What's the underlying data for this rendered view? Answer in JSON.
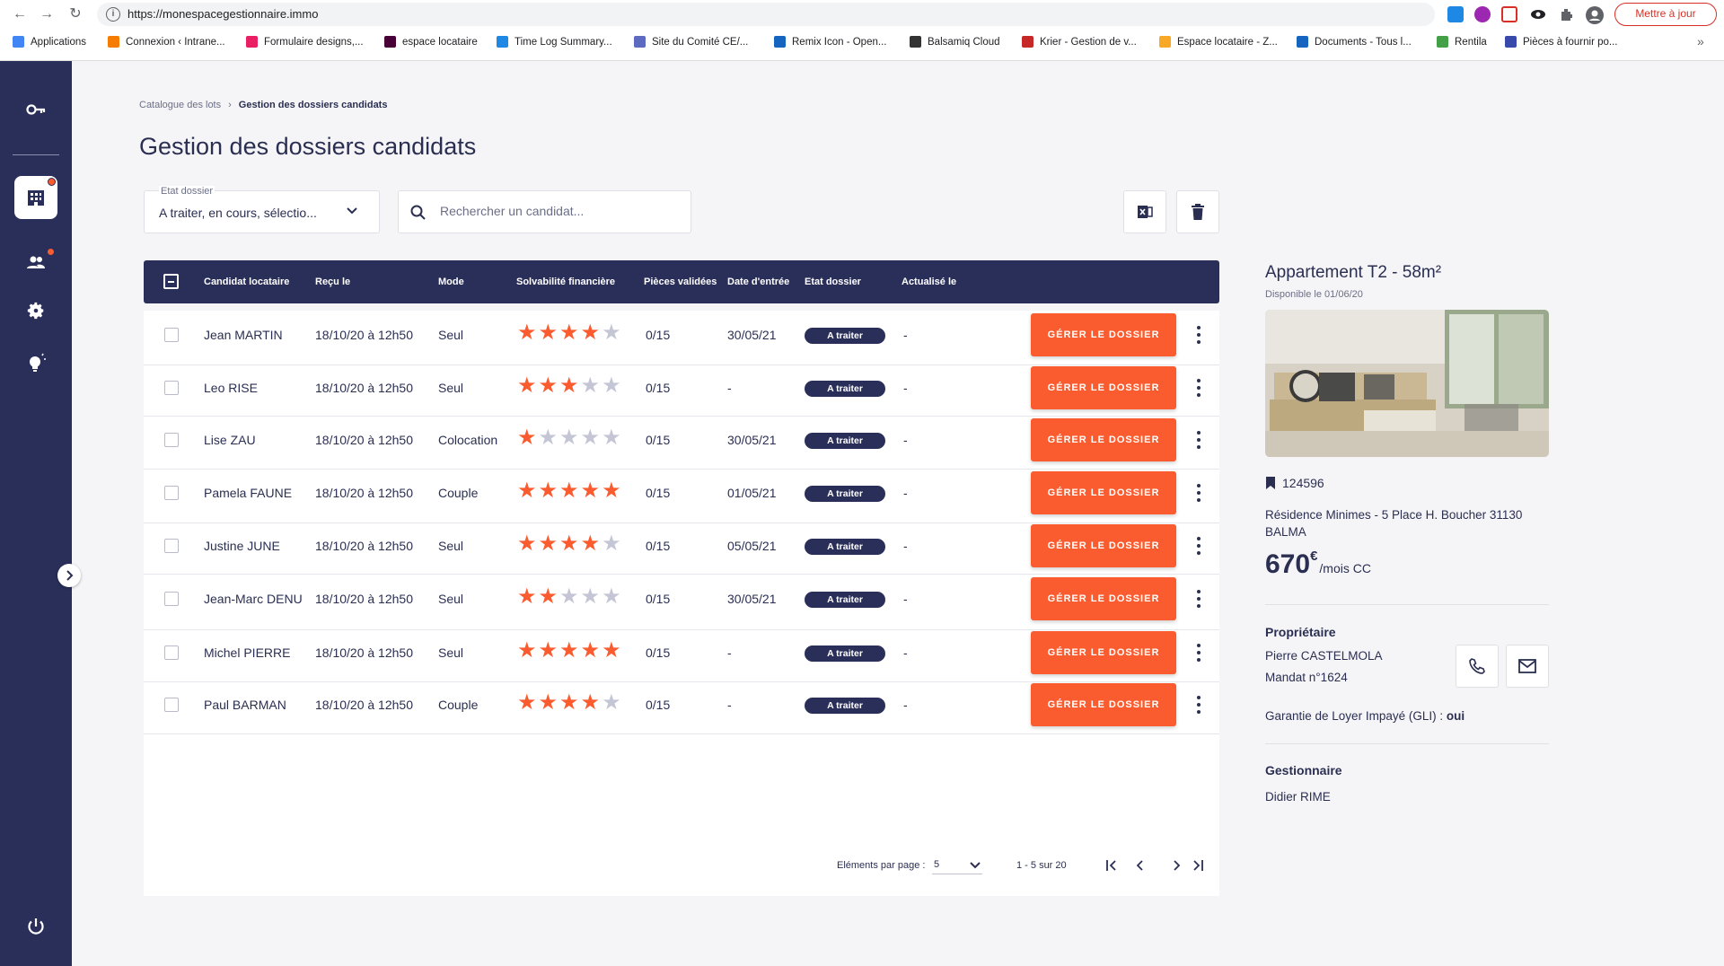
{
  "browser": {
    "url": "https://monespacegestionnaire.immo",
    "update_label": "Mettre à jour",
    "bookmarks": [
      {
        "label": "Applications",
        "color": "#4285f4"
      },
      {
        "label": "Connexion ‹ Intrane...",
        "color": "#f57c00"
      },
      {
        "label": "Formulaire designs,...",
        "color": "#e91e63"
      },
      {
        "label": "espace locataire",
        "color": "#470137"
      },
      {
        "label": "Time Log Summary...",
        "color": "#1e88e5"
      },
      {
        "label": "Site du Comité CE/...",
        "color": "#5c6bc0"
      },
      {
        "label": "Remix Icon - Open...",
        "color": "#1565c0"
      },
      {
        "label": "Balsamiq Cloud",
        "color": "#333333"
      },
      {
        "label": "Krier - Gestion de v...",
        "color": "#c62828"
      },
      {
        "label": "Espace locataire - Z...",
        "color": "#f9a825"
      },
      {
        "label": "Documents - Tous l...",
        "color": "#1565c0"
      },
      {
        "label": "Rentila",
        "color": "#43a047"
      },
      {
        "label": "Pièces à fournir po...",
        "color": "#3949ab"
      }
    ],
    "bookmarks_more": "»"
  },
  "breadcrumb": {
    "parent": "Catalogue des lots",
    "separator": "›",
    "current": "Gestion des dossiers candidats"
  },
  "page": {
    "title": "Gestion des dossiers candidats"
  },
  "filters": {
    "status_label": "Etat dossier",
    "status_value": "A traiter, en cours, sélectio...",
    "search_placeholder": "Rechercher un candidat..."
  },
  "table": {
    "columns": {
      "candidate": "Candidat locataire",
      "received": "Reçu le",
      "mode": "Mode",
      "solvency": "Solvabilité financière",
      "pieces": "Pièces validées",
      "entry": "Date d'entrée",
      "status": "Etat dossier",
      "updated": "Actualisé le"
    },
    "action_label": "GÉRER LE DOSSIER",
    "rows": [
      {
        "name": "Jean MARTIN",
        "received": "18/10/20 à 12h50",
        "mode": "Seul",
        "stars": 4,
        "pieces": "0/15",
        "entry": "30/05/21",
        "status": "A traiter",
        "updated": "-"
      },
      {
        "name": "Leo RISE",
        "received": "18/10/20 à 12h50",
        "mode": "Seul",
        "stars": 3,
        "pieces": "0/15",
        "entry": "-",
        "status": "A traiter",
        "updated": "-"
      },
      {
        "name": "Lise ZAU",
        "received": "18/10/20 à 12h50",
        "mode": "Colocation",
        "stars": 1,
        "pieces": "0/15",
        "entry": "30/05/21",
        "status": "A traiter",
        "updated": "-"
      },
      {
        "name": "Pamela FAUNE",
        "received": "18/10/20 à 12h50",
        "mode": "Couple",
        "stars": 5,
        "pieces": "0/15",
        "entry": "01/05/21",
        "status": "A traiter",
        "updated": "-"
      },
      {
        "name": "Justine JUNE",
        "received": "18/10/20 à 12h50",
        "mode": "Seul",
        "stars": 4,
        "pieces": "0/15",
        "entry": "05/05/21",
        "status": "A traiter",
        "updated": "-"
      },
      {
        "name": "Jean-Marc DENU",
        "received": "18/10/20 à 12h50",
        "mode": "Seul",
        "stars": 2,
        "pieces": "0/15",
        "entry": "30/05/21",
        "status": "A traiter",
        "updated": "-"
      },
      {
        "name": "Michel PIERRE",
        "received": "18/10/20 à 12h50",
        "mode": "Seul",
        "stars": 5,
        "pieces": "0/15",
        "entry": "-",
        "status": "A traiter",
        "updated": "-"
      },
      {
        "name": "Paul BARMAN",
        "received": "18/10/20 à 12h50",
        "mode": "Couple",
        "stars": 4,
        "pieces": "0/15",
        "entry": "-",
        "status": "A traiter",
        "updated": "-"
      }
    ]
  },
  "pagination": {
    "per_page_label": "Eléments par page :",
    "per_page_value": "5",
    "range": "1 - 5 sur 20"
  },
  "property": {
    "title": "Appartement T2 - 58m²",
    "availability": "Disponible le 01/06/20",
    "reference": "124596",
    "address": "Résidence Minimes - 5 Place H. Boucher 31130 BALMA",
    "price": "670",
    "currency": "€",
    "price_suffix": "/mois CC",
    "owner_title": "Propriétaire",
    "owner_name": "Pierre CASTELMOLA",
    "mandate": "Mandat n°1624",
    "gli_label": "Garantie de Loyer Impayé (GLI) :",
    "gli_value": "oui",
    "manager_title": "Gestionnaire",
    "manager_name": "Didier RIME"
  },
  "colors": {
    "navy": "#2a2f5a",
    "accent": "#fb5c2f",
    "star_empty": "#c4c6d6"
  }
}
